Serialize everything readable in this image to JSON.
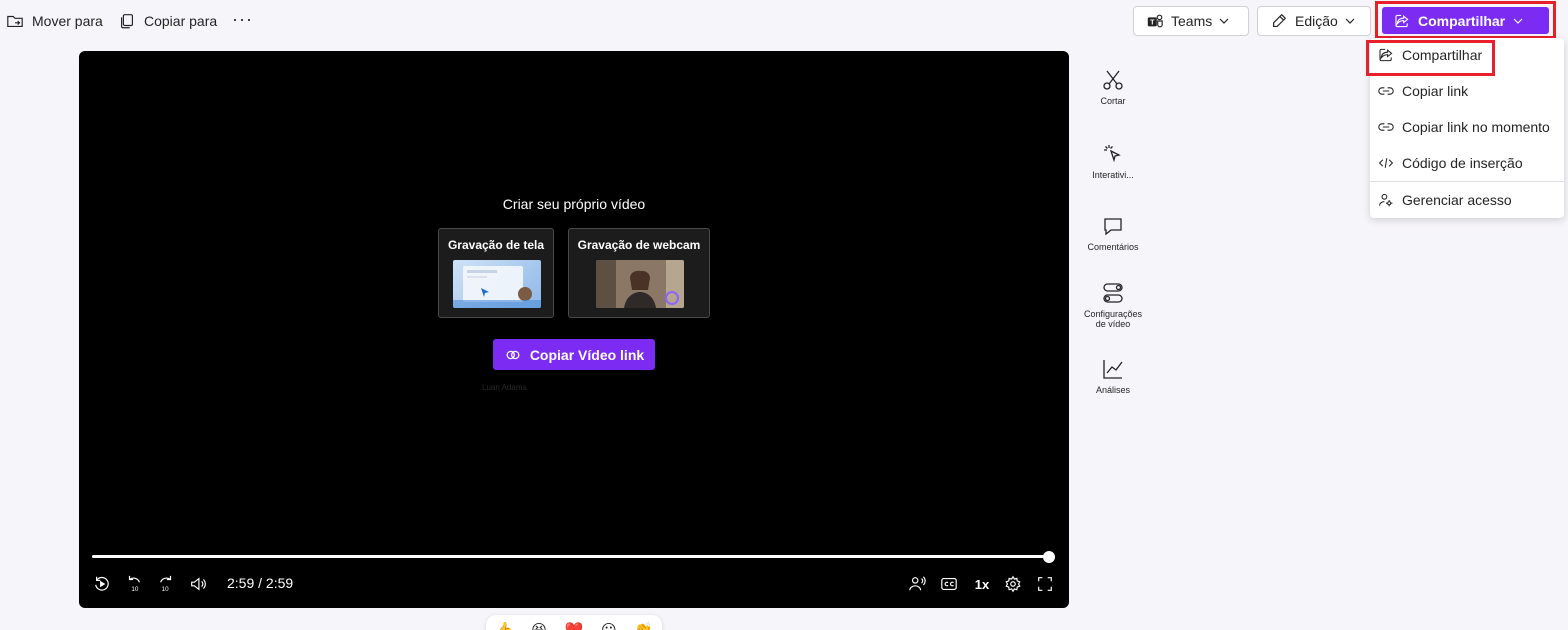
{
  "toolbar": {
    "move_label": "Mover para",
    "copy_label": "Copiar para",
    "more_label": "···",
    "teams_label": "Teams",
    "edit_label": "Edição",
    "share_label": "Compartilhar"
  },
  "share_menu": {
    "items": [
      {
        "label": "Compartilhar",
        "icon": "share-icon"
      },
      {
        "label": "Copiar link",
        "icon": "link-icon"
      },
      {
        "label": "Copiar link no momento",
        "icon": "link-icon"
      },
      {
        "label": "Código de inserção",
        "icon": "code-icon"
      },
      {
        "label": "Gerenciar acesso",
        "icon": "person-gear-icon"
      }
    ]
  },
  "player": {
    "create_title": "Criar seu próprio vídeo",
    "card_screen_title": "Gravação de tela",
    "card_webcam_title": "Gravação de webcam",
    "copy_link_label": "Copiar Vídeo link",
    "ghost_name": "Luan Adams",
    "time": "2:59 / 2:59",
    "speed": "1x",
    "progress": 1.0,
    "skip_back": "10",
    "skip_fwd": "10"
  },
  "rail": {
    "items": [
      {
        "label": "Cortar",
        "icon": "scissors-icon"
      },
      {
        "label": "Interativi...",
        "icon": "cursor-click-icon"
      },
      {
        "label": "Comentários",
        "icon": "comment-icon"
      },
      {
        "label": "Configurações de vídeo",
        "icon": "toggle-settings-icon"
      },
      {
        "label": "Análises",
        "icon": "chart-line-icon"
      }
    ]
  },
  "reactions": [
    "👍",
    "😆",
    "❤️",
    "😮",
    "👏"
  ],
  "colors": {
    "accent": "#7b2bf2",
    "highlight_border": "#e8202a",
    "background": "#f6f5f9",
    "player_bg": "#000000"
  }
}
